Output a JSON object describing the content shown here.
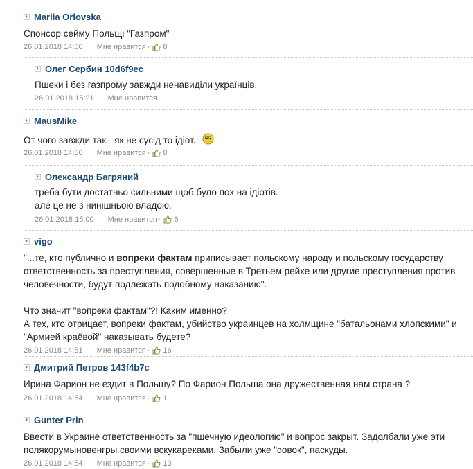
{
  "comments": [
    {
      "author": "Mariia Orlovska",
      "text": "Спонсор сейму Польщі \"Газпром\"",
      "date": "26.01.2018 14:50",
      "like_label": "Мне нравится",
      "likes": "8"
    },
    {
      "author": "Олег Сербин 10d6f9ec",
      "text": "Пшеки і без газпрому завжди ненавиділи українців.",
      "date": "26.01.2018 15:21",
      "like_label": "Мне нравится"
    },
    {
      "author": "MausMike",
      "text": "От чого завжди так - як не сусід то ідіот.",
      "emoticon": "confused-smiley-icon",
      "date": "26.01.2018 14:50",
      "like_label": "Мне нравится",
      "likes": "8"
    },
    {
      "author": "Олександр Багряний",
      "text_line1": "треба бути достатньо сильними щоб було пох на ідіотів.",
      "text_line2": "але це не з нинішньою владою.",
      "date": "26.01.2018 15:00",
      "like_label": "Мне нравится",
      "likes": "6"
    },
    {
      "author": "vigo",
      "quote_pre": "\"...те, кто публично и ",
      "quote_bold": "вопреки фактам",
      "quote_post": " приписывает польскому народу и польскому государству",
      "quote_line2": "ответственность за преступления, совершенные в Третьем рейхе или другие преступления против",
      "quote_line3": "человечности, будут подлежать подобному наказанию\".",
      "line4": "Что значит \"вопреки фактам\"?! Каким именно?",
      "line5": "А тех, кто отрицает, вопреки фактам, убийство украинцев на холмщине \"батальонами хлопскими\" и",
      "line6": "\"Армией краёвой\" наказывать будете?",
      "date": "26.01.2018 14:51",
      "like_label": "Мне нравится",
      "likes": "16"
    },
    {
      "author": "Дмитрий Петров 143f4b7c",
      "text": "Ирина Фарион не ездит в Польшу? По Фарион Польша она дружественная нам страна ?",
      "date": "26.01.2018 14:54",
      "like_label": "Мне нравится",
      "likes": "1"
    },
    {
      "author": "Gunter Prin",
      "text_line1": "Ввести в Украине ответственность за \"пшечную идеологию\" и вопрос закрыт. Задолбали уже эти",
      "text_line2": "полякорумыновенгры своими вскукареками. Забыли уже \"совок\", паскуды.",
      "date": "26.01.2018 14:54",
      "like_label": "Мне нравится",
      "likes": "13"
    }
  ],
  "dot": "·"
}
